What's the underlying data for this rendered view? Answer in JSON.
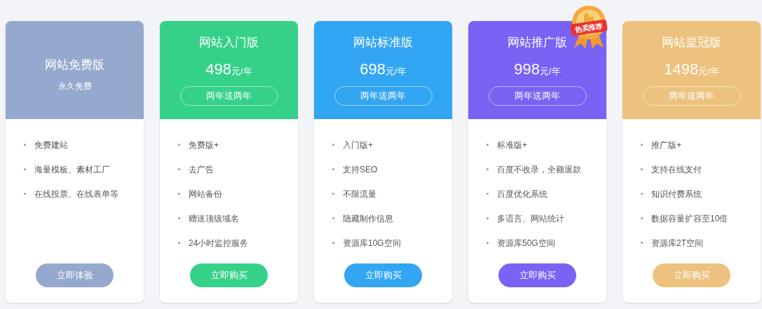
{
  "plans": [
    {
      "kind": "free",
      "name": "网站免费版",
      "subtitle": "永久免费",
      "color": "#95a9cf",
      "features": [
        "免费建站",
        "海量模板、素材工厂",
        "在线投票、在线表单等"
      ],
      "button": "立即体验"
    },
    {
      "kind": "paid",
      "name": "网站入门版",
      "price": "498",
      "unit": "元/年",
      "gift": "两年送两年",
      "color": "#36d189",
      "features": [
        "免费版+",
        "去广告",
        "网站备份",
        "赠送顶级域名",
        "24小时监控服务"
      ],
      "button": "立即购买"
    },
    {
      "kind": "paid",
      "name": "网站标准版",
      "price": "698",
      "unit": "元/年",
      "gift": "两年送两年",
      "color": "#33a6f3",
      "features": [
        "入门版+",
        "支持SEO",
        "不限流量",
        "隐藏制作信息",
        "资源库10G空间"
      ],
      "button": "立即购买"
    },
    {
      "kind": "paid",
      "name": "网站推广版",
      "price": "998",
      "unit": "元/年",
      "gift": "两年送两年",
      "color": "#7a62f5",
      "badge": "热卖推荐",
      "features": [
        "标准版+",
        "百度不收录，全额退款",
        "百度优化系统",
        "多语言、网站统计",
        "资源库50G空间"
      ],
      "button": "立即购买"
    },
    {
      "kind": "paid",
      "name": "网站皇冠版",
      "price": "1498",
      "unit": "元/年",
      "gift": "两年送两年",
      "color": "#ecc27e",
      "features": [
        "推广版+",
        "支持在线支付",
        "知识付费系统",
        "数据容量扩容至10倍",
        "资源库2T空间"
      ],
      "button": "立即购买"
    }
  ]
}
